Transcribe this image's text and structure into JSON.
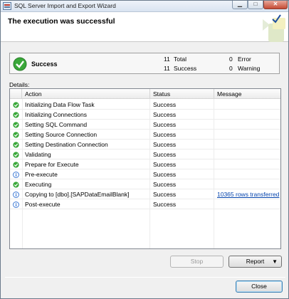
{
  "window": {
    "title": "SQL Server Import and Export Wizard"
  },
  "header": {
    "title": "The execution was successful"
  },
  "summary": {
    "status_label": "Success",
    "total_count": "11",
    "total_label": "Total",
    "success_count": "11",
    "success_label": "Success",
    "error_count": "0",
    "error_label": "Error",
    "warning_count": "0",
    "warning_label": "Warning"
  },
  "details": {
    "label": "Details:",
    "columns": [
      "Action",
      "Status",
      "Message"
    ],
    "rows": [
      {
        "icon": "success-check-icon",
        "action": "Initializing Data Flow Task",
        "status": "Success",
        "message": ""
      },
      {
        "icon": "success-check-icon",
        "action": "Initializing Connections",
        "status": "Success",
        "message": ""
      },
      {
        "icon": "success-check-icon",
        "action": "Setting SQL Command",
        "status": "Success",
        "message": ""
      },
      {
        "icon": "success-check-icon",
        "action": "Setting Source Connection",
        "status": "Success",
        "message": ""
      },
      {
        "icon": "success-check-icon",
        "action": "Setting Destination Connection",
        "status": "Success",
        "message": ""
      },
      {
        "icon": "success-check-icon",
        "action": "Validating",
        "status": "Success",
        "message": ""
      },
      {
        "icon": "success-check-icon",
        "action": "Prepare for Execute",
        "status": "Success",
        "message": ""
      },
      {
        "icon": "info-icon",
        "action": "Pre-execute",
        "status": "Success",
        "message": ""
      },
      {
        "icon": "success-check-icon",
        "action": "Executing",
        "status": "Success",
        "message": ""
      },
      {
        "icon": "info-icon",
        "action": "Copying to [dbo].[SAPDataEmailBlank]",
        "status": "Success",
        "message": "10365 rows transferred"
      },
      {
        "icon": "info-icon",
        "action": "Post-execute",
        "status": "Success",
        "message": ""
      }
    ]
  },
  "buttons": {
    "stop": "Stop",
    "report": "Report",
    "close": "Close"
  },
  "colors": {
    "success_green": "#3aa83a",
    "info_blue": "#2f6fd1",
    "link": "#0645ad"
  }
}
